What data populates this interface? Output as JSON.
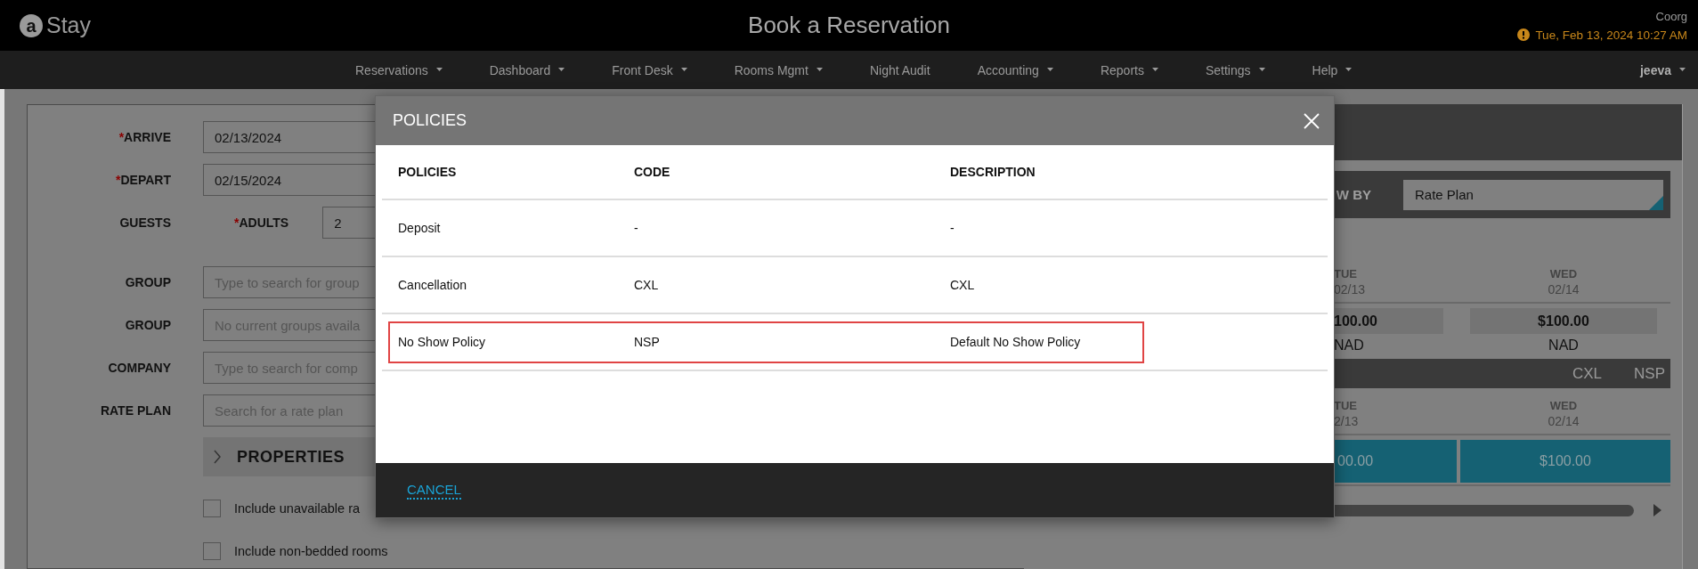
{
  "header": {
    "logo": {
      "mark": "a",
      "name": "Stay"
    },
    "title": "Book a Reservation",
    "property": "Coorg",
    "datetime": "Tue, Feb 13, 2024 10:27 AM"
  },
  "nav": {
    "items": [
      {
        "label": "Reservations",
        "dropdown": true
      },
      {
        "label": "Dashboard",
        "dropdown": true
      },
      {
        "label": "Front Desk",
        "dropdown": true
      },
      {
        "label": "Rooms Mgmt",
        "dropdown": true
      },
      {
        "label": "Night Audit",
        "dropdown": false
      },
      {
        "label": "Accounting",
        "dropdown": true
      },
      {
        "label": "Reports",
        "dropdown": true
      },
      {
        "label": "Settings",
        "dropdown": true
      },
      {
        "label": "Help",
        "dropdown": true
      }
    ],
    "user": {
      "label": "jeeva",
      "dropdown": true
    }
  },
  "form": {
    "fields": [
      {
        "kind": "text",
        "label": "ARRIVE",
        "mark": "*",
        "value": "02/13/2024"
      },
      {
        "kind": "text",
        "label": "DEPART",
        "mark": "*",
        "value": "02/15/2024"
      },
      {
        "kind": "guests",
        "label": "GUESTS",
        "sublabel": "ADULTS",
        "submark": "*",
        "value": "2"
      },
      {
        "kind": "text",
        "label": "GROUP",
        "placeholder": "Type to search for group"
      },
      {
        "kind": "text",
        "label": "GROUP",
        "placeholder": "No current groups availa"
      },
      {
        "kind": "text",
        "label": "COMPANY",
        "placeholder": "Type to search for comp"
      },
      {
        "kind": "text",
        "label": "RATE PLAN",
        "placeholder": "Search for a rate plan"
      }
    ],
    "properties": {
      "label": "PROPERTIES",
      "expanded": false
    },
    "options": [
      {
        "label": "Include unavailable ra",
        "checked": false
      },
      {
        "label": "Include non-bedded rooms",
        "checked": false
      }
    ]
  },
  "rates": {
    "view_by_label": "W BY",
    "view_by_value": "Rate Plan",
    "days": [
      {
        "weekday": "TUE",
        "date": "02/13",
        "price": "100.00",
        "currency": "NAD"
      },
      {
        "weekday": "WED",
        "date": "02/14",
        "price": "$100.00",
        "currency": "NAD"
      }
    ],
    "policy_codes": [
      "CXL",
      "NSP"
    ],
    "days2": [
      {
        "weekday": "TUE",
        "date": "2/13",
        "rate": "00.00"
      },
      {
        "weekday": "WED",
        "date": "02/14",
        "rate": "$100.00"
      }
    ]
  },
  "modal": {
    "title": "POLICIES",
    "columns": [
      "POLICIES",
      "CODE",
      "DESCRIPTION"
    ],
    "rows": [
      {
        "cells": [
          "Deposit",
          "-",
          "-"
        ],
        "highlighted": false
      },
      {
        "cells": [
          "Cancellation",
          "CXL",
          "CXL"
        ],
        "highlighted": false
      },
      {
        "cells": [
          "No Show Policy",
          "NSP",
          "Default No Show Policy"
        ],
        "highlighted": true
      }
    ],
    "footer_link": "CANCEL"
  }
}
